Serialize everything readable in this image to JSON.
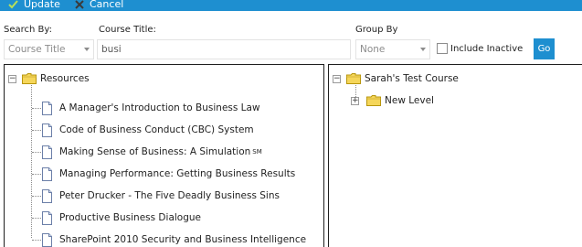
{
  "toolbar": {
    "update_label": "Update",
    "cancel_label": "Cancel",
    "background_color": "#1e8fd0"
  },
  "filters": {
    "search_by_label": "Search By:",
    "search_by_value": "Course Title",
    "course_title_label": "Course Title:",
    "course_title_value": "busi",
    "group_by_label": "Group By",
    "group_by_value": "None",
    "include_inactive_label": "Include Inactive",
    "include_inactive_checked": false,
    "go_label": "Go"
  },
  "left_tree": {
    "root": {
      "label": "Resources",
      "icon": "folder-icon",
      "expanded": true
    },
    "children": [
      {
        "label": "A Manager's Introduction to Business Law",
        "sup": ""
      },
      {
        "label": "Code of Business Conduct (CBC) System",
        "sup": ""
      },
      {
        "label": "Making Sense of Business: A Simulation",
        "sup": "SM"
      },
      {
        "label": "Managing Performance: Getting Business Results",
        "sup": ""
      },
      {
        "label": "Peter Drucker - The Five Deadly Business Sins",
        "sup": ""
      },
      {
        "label": "Productive Business Dialogue",
        "sup": ""
      },
      {
        "label": "SharePoint 2010 Security and Business Intelligence",
        "sup": ""
      }
    ]
  },
  "right_tree": {
    "root": {
      "label": "Sarah's Test Course",
      "icon": "folder-icon",
      "expanded": true
    },
    "children": [
      {
        "label": "New Level",
        "expanded": false
      }
    ]
  }
}
